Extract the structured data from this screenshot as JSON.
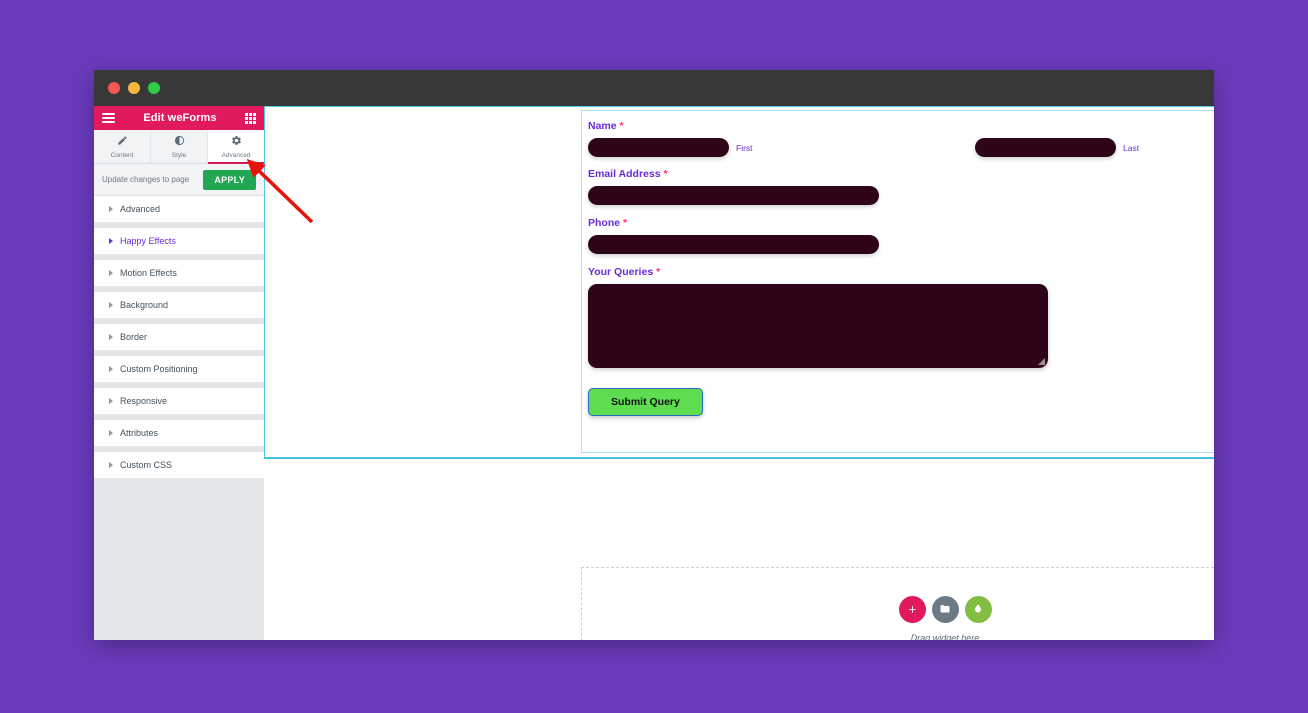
{
  "window": {
    "traffic_lights": [
      "close",
      "minimize",
      "maximize"
    ]
  },
  "panel": {
    "menu_icon": "hamburger-icon",
    "title": "Edit weForms",
    "grid_icon": "grid-apps-icon",
    "tabs": [
      {
        "label": "Content",
        "icon": "pencil-icon",
        "active": false
      },
      {
        "label": "Style",
        "icon": "contrast-icon",
        "active": false
      },
      {
        "label": "Advanced",
        "icon": "gear-icon",
        "active": true
      }
    ],
    "apply_row": {
      "hint": "Update changes to page",
      "button_label": "APPLY"
    },
    "sections": [
      {
        "label": "Advanced",
        "highlight": false
      },
      {
        "label": "Happy Effects",
        "highlight": true
      },
      {
        "label": "Motion Effects",
        "highlight": false
      },
      {
        "label": "Background",
        "highlight": false
      },
      {
        "label": "Border",
        "highlight": false
      },
      {
        "label": "Custom Positioning",
        "highlight": false
      },
      {
        "label": "Responsive",
        "highlight": false
      },
      {
        "label": "Attributes",
        "highlight": false
      },
      {
        "label": "Custom CSS",
        "highlight": false
      }
    ],
    "collapse_handle": "‹"
  },
  "element_toolbar": {
    "icons": [
      "plus-icon",
      "drag-handle-icon",
      "duplicate-icon",
      "close-icon"
    ],
    "plus": "+",
    "duplicate": "❐",
    "close": "✕"
  },
  "form": {
    "required_mark": "*",
    "fields": [
      {
        "label": "Name",
        "required": true
      },
      {
        "label": "Email Address",
        "required": true
      },
      {
        "label": "Phone",
        "required": true
      },
      {
        "label": "Your Queries",
        "required": true
      }
    ],
    "name_sub_labels": {
      "first": "First",
      "last": "Last"
    },
    "submit_label": "Submit Query"
  },
  "drop_zone": {
    "label": "Drag widget here",
    "buttons": [
      {
        "name": "add-widget-button",
        "icon": "plus-icon",
        "color": "#e01a5b"
      },
      {
        "name": "template-folder-button",
        "icon": "folder-icon",
        "color": "#6b7a87"
      },
      {
        "name": "leaf-widget-button",
        "icon": "leaf-icon",
        "color": "#83bc43"
      }
    ]
  },
  "colors": {
    "desktop": "#6b3bbd",
    "panel_header": "#e01a5b",
    "apply_green": "#21a654",
    "label_purple": "#6c2bd9",
    "required_pink": "#ff2d6f",
    "input_dark": "#2d0418",
    "submit_green": "#5ddd4f",
    "section_outline": "#49bfe0",
    "toolbar_blue": "#63cdf0",
    "annotation_red": "#e8120c"
  }
}
